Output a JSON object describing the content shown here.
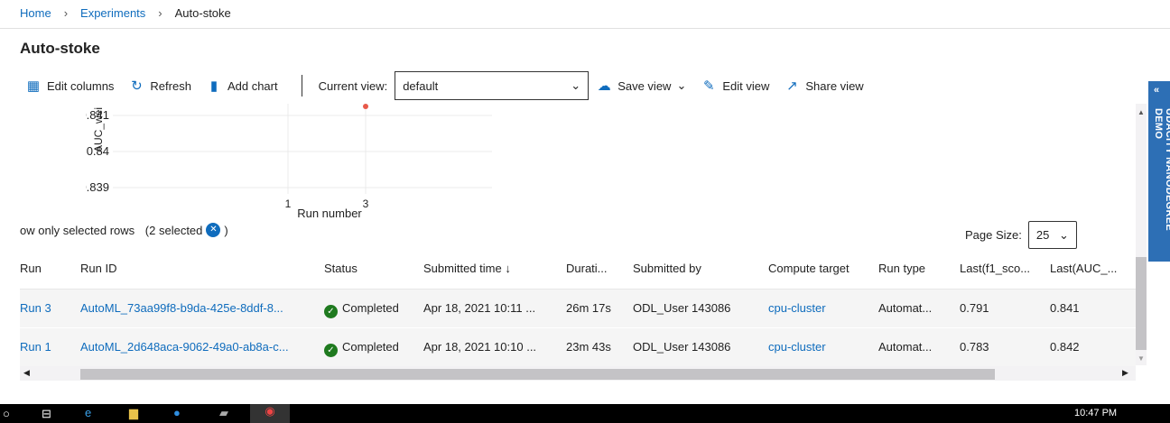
{
  "breadcrumb": [
    "Home",
    "Experiments",
    "Auto-stoke"
  ],
  "title": "Auto-stoke",
  "toolbar": {
    "edit_columns": "Edit columns",
    "refresh": "Refresh",
    "add_chart": "Add chart",
    "current_view_label": "Current view:",
    "current_view_value": "default",
    "save_view": "Save view",
    "edit_view": "Edit view",
    "share_view": "Share view"
  },
  "side_panel": "UDACITY NANODEGREE DEMO",
  "chart_data": {
    "type": "scatter",
    "xlabel": "Run number",
    "ylabel": "AUC_wei",
    "x_ticks": [
      "1",
      "3"
    ],
    "y_ticks": [
      "0.841",
      "0.84",
      "0.839"
    ],
    "ylim": [
      0.8385,
      0.8413
    ],
    "points": [
      {
        "x": 3,
        "y": 0.8412
      }
    ],
    "color": "#e8594a",
    "grid": true
  },
  "selection": {
    "text": "ow only selected rows",
    "count": "(2 selected",
    "close": ")"
  },
  "page_size": {
    "label": "Page Size:",
    "value": "25"
  },
  "table": {
    "columns": [
      "Run",
      "Run ID",
      "Status",
      "Submitted time ↓",
      "Durati...",
      "Submitted by",
      "Compute target",
      "Run type",
      "Last(f1_sco...",
      "Last(AUC_..."
    ],
    "rows": [
      [
        "Run 3",
        "AutoML_73aa99f8-b9da-425e-8ddf-8...",
        "Completed",
        "Apr 18, 2021 10:11 ...",
        "26m 17s",
        "ODL_User 143086",
        "cpu-cluster",
        "Automat...",
        "0.791",
        "0.841"
      ],
      [
        "Run 1",
        "AutoML_2d648aca-9062-49a0-ab8a-c...",
        "Completed",
        "Apr 18, 2021 10:10 ...",
        "23m 43s",
        "ODL_User 143086",
        "cpu-cluster",
        "Automat...",
        "0.783",
        "0.842"
      ]
    ]
  },
  "taskbar": {
    "time": "10:47 PM"
  }
}
